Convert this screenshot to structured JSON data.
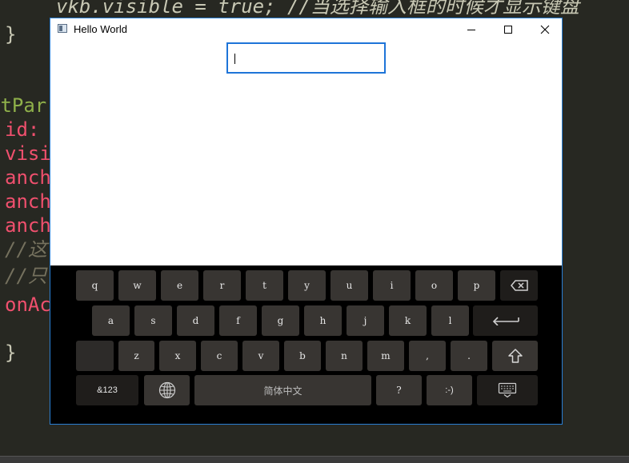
{
  "editor": {
    "line_top": "vkb.visible = true; //当选择输入框的时候才显示键盘",
    "brace1": "}",
    "line_parent": "utPar",
    "line_id": "id: ",
    "line_visi": "visi",
    "line_anch1": "anch",
    "line_anch2": "anch",
    "line_anch3": "anch",
    "line_comment1": "//这",
    "line_comment2": "//只",
    "line_onac": "onAc",
    "brace2": "}"
  },
  "window": {
    "title": "Hello World",
    "accent": "#1e74d8"
  },
  "input": {
    "value": ""
  },
  "keyboard": {
    "row1": [
      "q",
      "w",
      "e",
      "r",
      "t",
      "y",
      "u",
      "i",
      "o",
      "p"
    ],
    "row2": [
      "a",
      "s",
      "d",
      "f",
      "g",
      "h",
      "j",
      "k",
      "l"
    ],
    "row3": [
      "z",
      "x",
      "c",
      "v",
      "b",
      "n",
      "m",
      ",",
      "."
    ],
    "symbols_label": "&123",
    "space_label": "简体中文",
    "question_label": "?",
    "smiley_label": ":-)",
    "icons": [
      "backspace-icon",
      "enter-icon",
      "shift-icon",
      "globe-icon",
      "hide-keyboard-icon"
    ]
  }
}
